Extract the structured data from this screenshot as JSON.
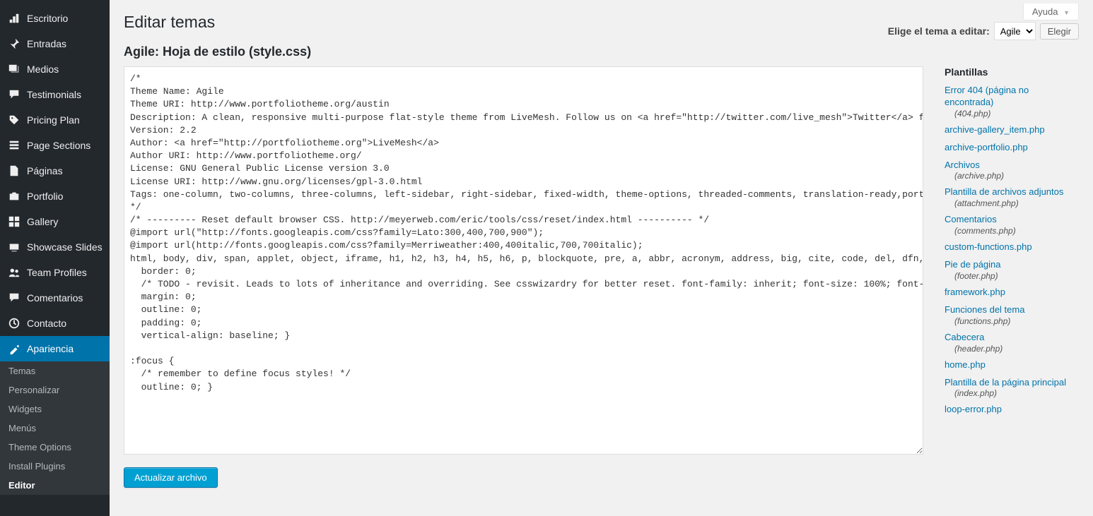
{
  "help_label": "Ayuda",
  "page_title": "Editar temas",
  "file_heading": "Agile: Hoja de estilo (style.css)",
  "theme_select_label": "Elige el tema a editar:",
  "theme_selected": "Agile",
  "choose_button": "Elegir",
  "submit_button": "Actualizar archivo",
  "sidebar": {
    "items": [
      {
        "label": "Escritorio",
        "icon": "dashboard"
      },
      {
        "label": "Entradas",
        "icon": "pin"
      },
      {
        "label": "Medios",
        "icon": "media"
      },
      {
        "label": "Testimonials",
        "icon": "testimonial"
      },
      {
        "label": "Pricing Plan",
        "icon": "tag"
      },
      {
        "label": "Page Sections",
        "icon": "page-sections"
      },
      {
        "label": "Páginas",
        "icon": "page"
      },
      {
        "label": "Portfolio",
        "icon": "portfolio"
      },
      {
        "label": "Gallery",
        "icon": "gallery"
      },
      {
        "label": "Showcase Slides",
        "icon": "slides"
      },
      {
        "label": "Team Profiles",
        "icon": "team"
      },
      {
        "label": "Comentarios",
        "icon": "comment"
      },
      {
        "label": "Contacto",
        "icon": "contact"
      },
      {
        "label": "Apariencia",
        "icon": "appearance",
        "active": true
      }
    ],
    "sub": [
      "Temas",
      "Personalizar",
      "Widgets",
      "Menús",
      "Theme Options",
      "Install Plugins",
      "Editor"
    ],
    "sub_current": "Editor"
  },
  "templates_heading": "Plantillas",
  "files": [
    {
      "label": "Error 404 (página no encontrada)",
      "file": "(404.php)"
    },
    {
      "label": "archive-gallery_item.php"
    },
    {
      "label": "archive-portfolio.php"
    },
    {
      "label": "Archivos",
      "file": "(archive.php)"
    },
    {
      "label": "Plantilla de archivos adjuntos",
      "file": "(attachment.php)"
    },
    {
      "label": "Comentarios",
      "file": "(comments.php)"
    },
    {
      "label": "custom-functions.php"
    },
    {
      "label": "Pie de página",
      "file": "(footer.php)"
    },
    {
      "label": "framework.php"
    },
    {
      "label": "Funciones del tema",
      "file": "(functions.php)"
    },
    {
      "label": "Cabecera",
      "file": "(header.php)"
    },
    {
      "label": "home.php"
    },
    {
      "label": "Plantilla de la página principal",
      "file": "(index.php)"
    },
    {
      "label": "loop-error.php"
    }
  ],
  "code": "/*\nTheme Name: Agile\nTheme URI: http://www.portfoliotheme.org/austin\nDescription: A clean, responsive multi-purpose flat-style theme from LiveMesh. Follow us on <a href=\"http://twitter.com/live_mesh\">Twitter</a> for updates\nVersion: 2.2\nAuthor: <a href=\"http://portfoliotheme.org\">LiveMesh</a>\nAuthor URI: http://www.portfoliotheme.org/\nLicense: GNU General Public License version 3.0\nLicense URI: http://www.gnu.org/licenses/gpl-3.0.html\nTags: one-column, two-columns, three-columns, left-sidebar, right-sidebar, fixed-width, theme-options, threaded-comments, translation-ready,portfolio,mobile,app,one-page,single-page,ios,android,tags\n*/\n/* --------- Reset default browser CSS. http://meyerweb.com/eric/tools/css/reset/index.html ---------- */\n@import url(\"http://fonts.googleapis.com/css?family=Lato:300,400,700,900\");\n@import url(http://fonts.googleapis.com/css?family=Merriweather:400,400italic,700,700italic);\nhtml, body, div, span, applet, object, iframe, h1, h2, h3, h4, h5, h6, p, blockquote, pre, a, abbr, acronym, address, big, cite, code, del, dfn, em, font, ins, kbd, q, s, samp, small, strike, strong, sub, sup, tt, var, dl, dt, dd, ol, ul, li, fieldset, form, label, legend, table, caption, tbody, tfoot, thead, tr, th, td, article, aside, canvas, details, figcaption, figure, footer, header, hgroup, menu, nav, section, summary, time, mark, audio, video {\n  border: 0;\n  /* TODO - revisit. Leads to lots of inheritance and overriding. See csswizardry for better reset. font-family: inherit; font-size: 100%; font-style: inherit; font-weight: inherit; */\n  margin: 0;\n  outline: 0;\n  padding: 0;\n  vertical-align: baseline; }\n\n:focus {\n  /* remember to define focus styles! */\n  outline: 0; }"
}
